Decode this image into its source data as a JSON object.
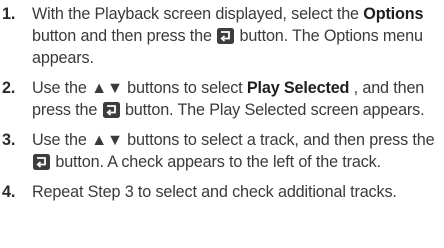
{
  "steps": [
    {
      "number": "1.",
      "t1": "With the Playback screen displayed, select the ",
      "b1": "Options",
      "t2": " button and then press the ",
      "t3": " button. The Options menu appears."
    },
    {
      "number": "2.",
      "t1": "Use the ▲▼ buttons to select ",
      "b1": "Play Selected",
      "t2": " , and then press the ",
      "t3": " button. The Play Selected screen appears."
    },
    {
      "number": "3.",
      "t1": "Use the ▲▼ buttons to select a track, and then press the ",
      "t3": " button. A check appears to the left of the track."
    },
    {
      "number": "4.",
      "t1": "Repeat Step 3 to select and check additional tracks."
    }
  ],
  "icons": {
    "enter": "enter-button-icon",
    "color": "#3d3d3d"
  }
}
